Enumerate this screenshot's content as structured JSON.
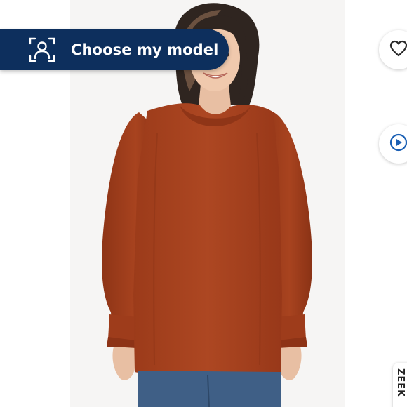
{
  "choose_model": {
    "label": "Choose my model",
    "icon": "person-scan-icon"
  },
  "actions": {
    "favorite_icon": "heart-icon",
    "video_icon": "play-icon"
  },
  "side_tab": {
    "label": "ZEEK"
  },
  "product_image": {
    "garment_color": "#a9431f",
    "background_color": "#f6f5f4"
  }
}
